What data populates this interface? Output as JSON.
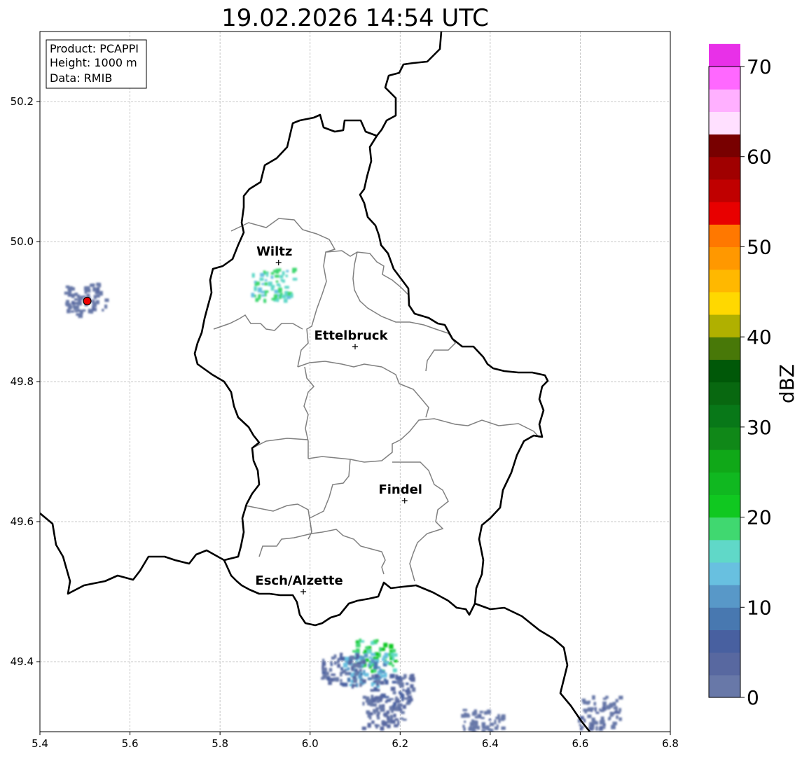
{
  "title": "19.02.2026 14:54 UTC",
  "info_box": {
    "product": "Product: PCAPPI",
    "height": "Height: 1000 m",
    "data": "Data: RMIB"
  },
  "axes": {
    "x_ticks": [
      "5.4",
      "5.6",
      "5.8",
      "6.0",
      "6.2",
      "6.4",
      "6.6",
      "6.8"
    ],
    "y_ticks": [
      "49.4",
      "49.6",
      "49.8",
      "50.0",
      "50.2"
    ],
    "x_range": [
      5.4,
      6.8
    ],
    "y_range": [
      49.3,
      50.3
    ],
    "grid": true
  },
  "colorbar": {
    "label": "dBZ",
    "ticks": [
      "0",
      "10",
      "20",
      "30",
      "40",
      "50",
      "60",
      "70"
    ],
    "range": [
      0,
      70
    ],
    "step": 2.5,
    "colors": [
      "#6878a8",
      "#5868a0",
      "#4860a0",
      "#4878b0",
      "#5898c8",
      "#68c0e0",
      "#60d8c8",
      "#40d870",
      "#10c820",
      "#10b820",
      "#10a818",
      "#108818",
      "#087818",
      "#086810",
      "#005808",
      "#487808",
      "#b0b000",
      "#ffd800",
      "#ffb800",
      "#ff9800",
      "#ff7800",
      "#e80000",
      "#c00000",
      "#a00000",
      "#780000",
      "#ffe0ff",
      "#ffb0ff",
      "#ff68ff",
      "#e830e8"
    ]
  },
  "cities": [
    {
      "name": "Wiltz",
      "lon": 5.93,
      "lat": 49.97
    },
    {
      "name": "Ettelbruck",
      "lon": 6.1,
      "lat": 49.85
    },
    {
      "name": "Findel",
      "lon": 6.21,
      "lat": 49.63
    },
    {
      "name": "Esch/Alzette",
      "lon": 5.985,
      "lat": 49.5
    }
  ],
  "radar_site": {
    "lon": 5.505,
    "lat": 49.915,
    "color": "#ee0000"
  },
  "echo_clusters": [
    {
      "lon": 6.14,
      "lat": 49.41,
      "dbz": 22
    },
    {
      "lon": 6.12,
      "lat": 49.39,
      "dbz": 15
    },
    {
      "lon": 6.18,
      "lat": 49.36,
      "dbz": 7
    },
    {
      "lon": 6.16,
      "lat": 49.33,
      "dbz": 4
    },
    {
      "lon": 6.07,
      "lat": 49.39,
      "dbz": 6
    },
    {
      "lon": 6.64,
      "lat": 49.33,
      "dbz": 4
    },
    {
      "lon": 6.38,
      "lat": 49.31,
      "dbz": 3
    },
    {
      "lon": 5.5,
      "lat": 49.92,
      "dbz": 3
    },
    {
      "lon": 5.915,
      "lat": 49.94,
      "dbz": 20
    }
  ]
}
